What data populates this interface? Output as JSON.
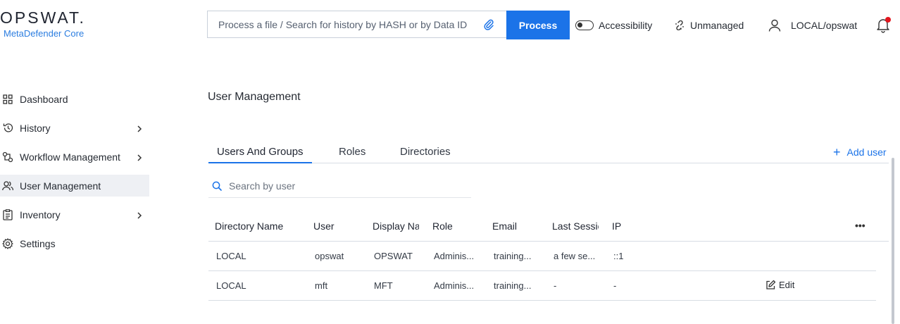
{
  "brand": {
    "name": "OPSWAT.",
    "product": "MetaDefender Core"
  },
  "search": {
    "placeholder": "Process a file / Search for history by HASH or by Data ID",
    "icon": "paperclip-icon"
  },
  "process_label": "Process",
  "topbar": {
    "accessibility": "Accessibility",
    "unmanaged": "Unmanaged",
    "user": "LOCAL/opswat",
    "notification_color": "#e3161e"
  },
  "sidebar": {
    "items": [
      {
        "label": "Dashboard",
        "icon": "dashboard-icon",
        "has_submenu": false
      },
      {
        "label": "History",
        "icon": "history-icon",
        "has_submenu": true
      },
      {
        "label": "Workflow Management",
        "icon": "workflow-icon",
        "has_submenu": true
      },
      {
        "label": "User Management",
        "icon": "users-icon",
        "has_submenu": false,
        "active": true
      },
      {
        "label": "Inventory",
        "icon": "clipboard-icon",
        "has_submenu": true
      },
      {
        "label": "Settings",
        "icon": "gear-icon",
        "has_submenu": false
      }
    ]
  },
  "main": {
    "title": "User Management",
    "tabs": [
      {
        "label": "Users And Groups",
        "active": true
      },
      {
        "label": "Roles"
      },
      {
        "label": "Directories"
      }
    ],
    "add_user": "Add user",
    "user_search_placeholder": "Search by user",
    "accent": "#1b73e8"
  },
  "table": {
    "columns": [
      "Directory Name",
      "User",
      "Display Na",
      "Role",
      "Email",
      "Last Sessic",
      "IP"
    ],
    "rows": [
      [
        "LOCAL",
        "opswat",
        "OPSWAT",
        "Adminis...",
        "training...",
        "a few se...",
        "::1"
      ],
      [
        "LOCAL",
        "mft",
        "MFT",
        "Adminis...",
        "training...",
        "-",
        "-"
      ]
    ],
    "row_action": "Edit",
    "more": "•••"
  }
}
